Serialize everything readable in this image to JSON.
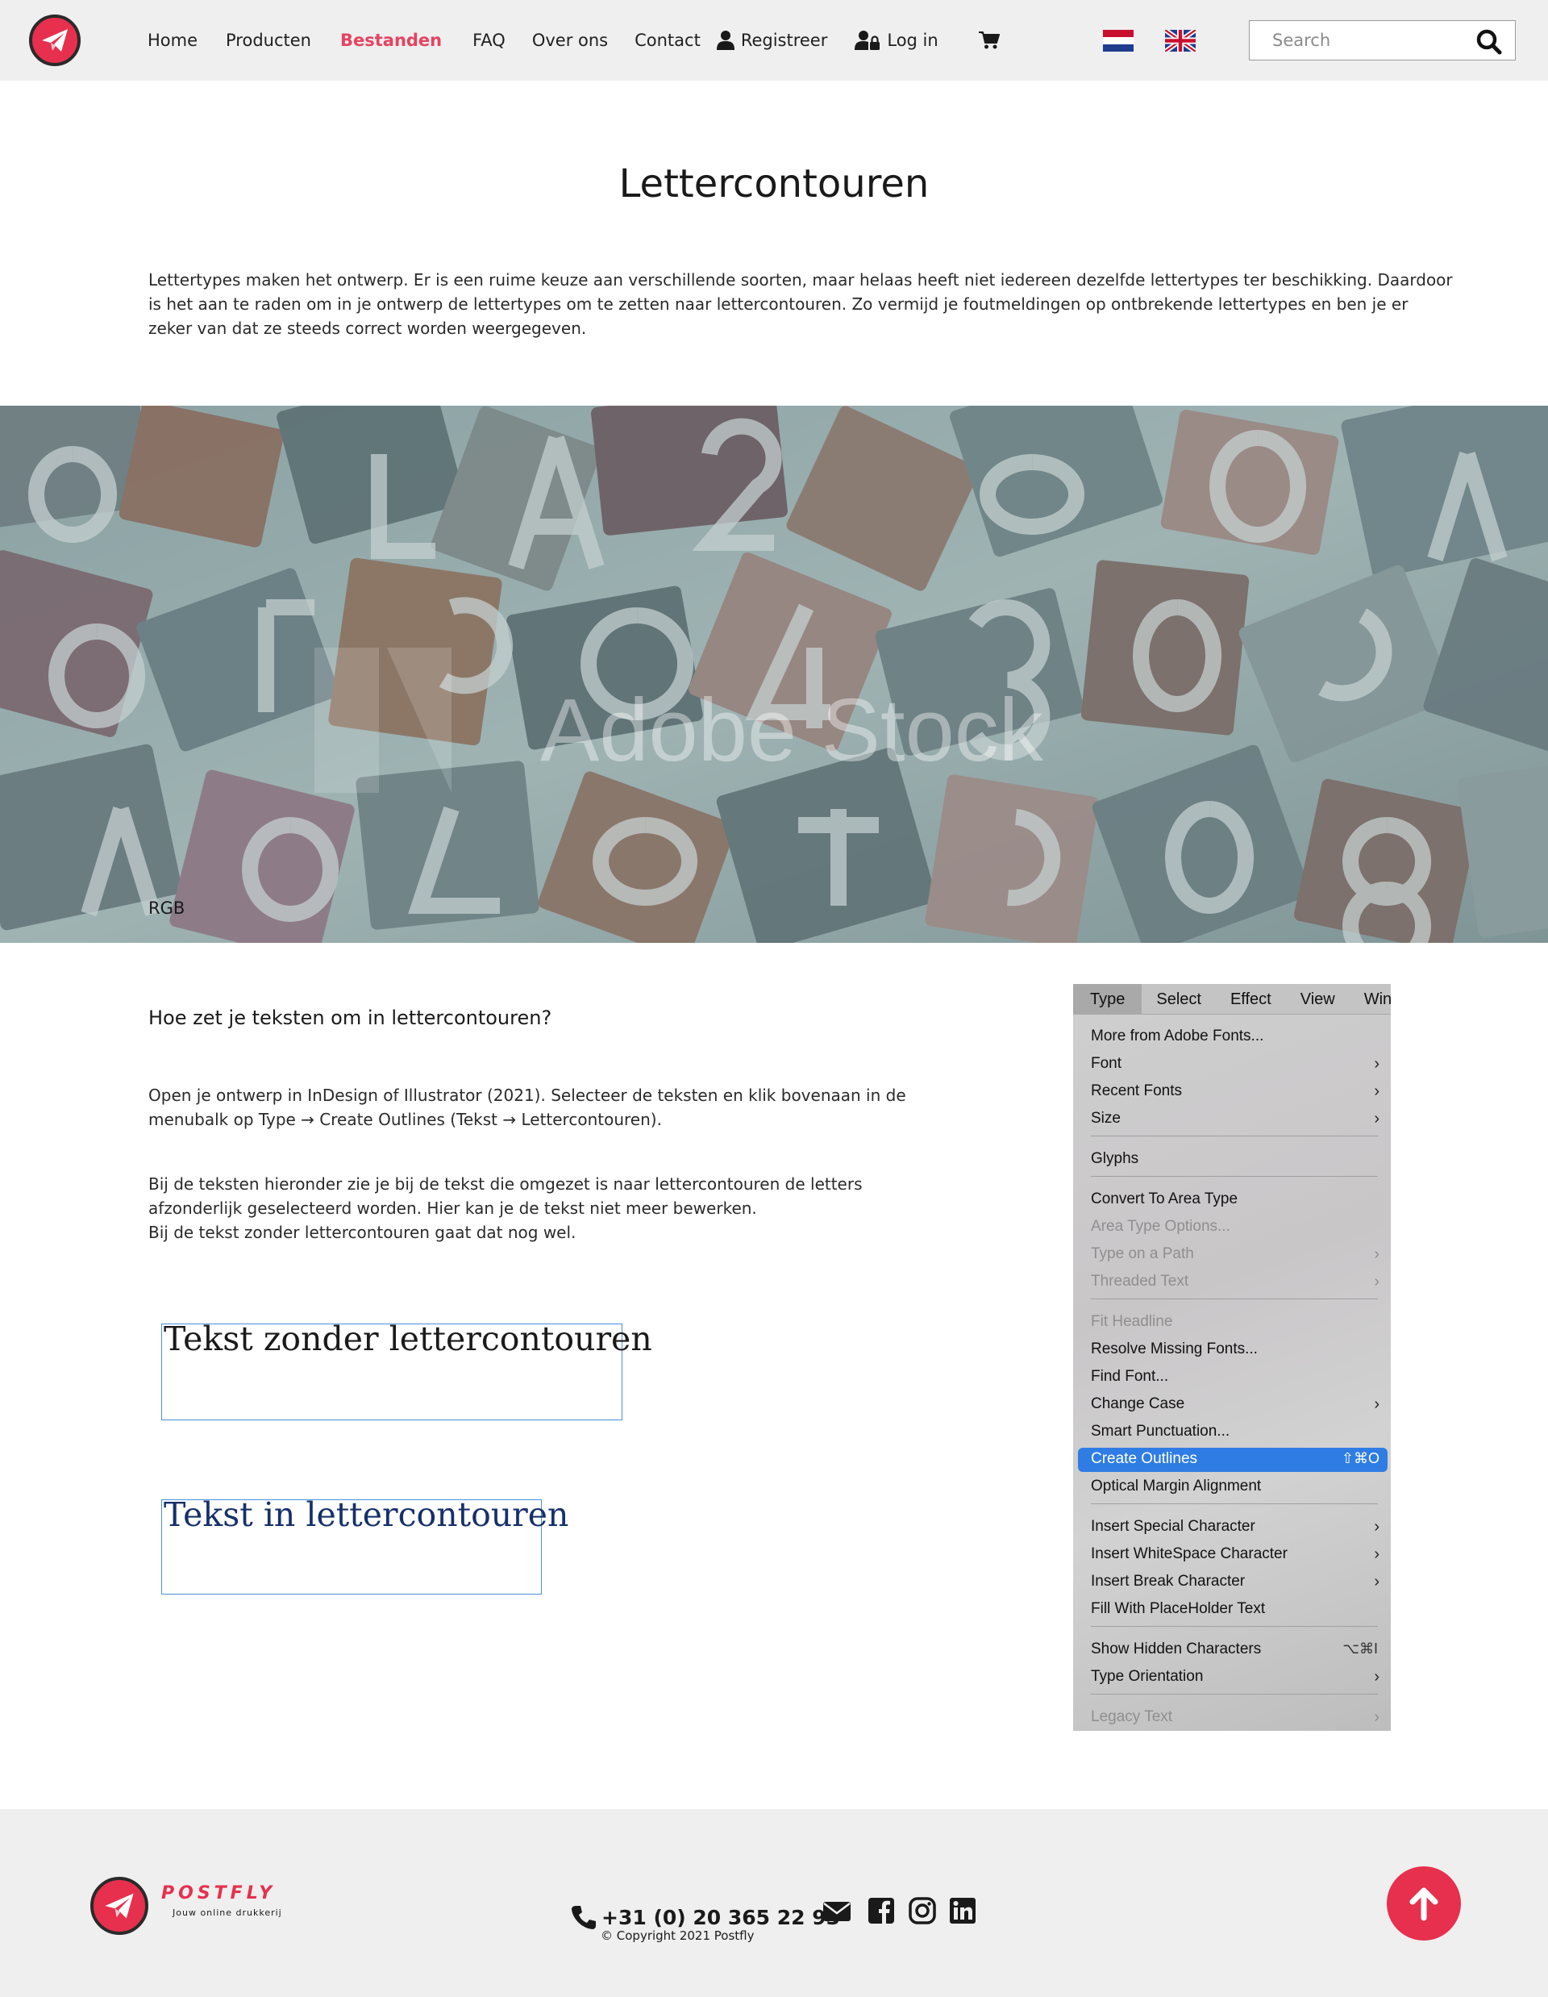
{
  "header": {
    "nav": [
      {
        "label": "Home",
        "active": false
      },
      {
        "label": "Producten",
        "active": false
      },
      {
        "label": "Bestanden",
        "active": true
      },
      {
        "label": "FAQ",
        "active": false
      },
      {
        "label": "Over ons",
        "active": false
      },
      {
        "label": "Contact",
        "active": false
      }
    ],
    "register_label": "Registreer",
    "login_label": "Log in",
    "search_placeholder": "Search",
    "icons": [
      "paper-plane-logo",
      "user-icon",
      "user-lock-icon",
      "cart-icon",
      "flag-nl",
      "flag-uk",
      "search-icon"
    ]
  },
  "main": {
    "title": "Lettercontouren",
    "intro": "Lettertypes maken het ontwerp. Er is een ruime keuze aan verschillende soorten, maar helaas heeft niet iedereen dezelfde lettertypes ter beschikking. Daardoor is het aan te raden om in je ontwerp de lettertypes om te zetten naar lettercontouren. Zo vermijd je foutmeldingen op ontbrekende lettertypes en ben je er zeker van dat ze steeds correct worden weergegeven.",
    "hero_watermark": "Adobe Stock",
    "hero_caption": "RGB",
    "heading": "Hoe zet je teksten om in lettercontouren?",
    "para1": "Open je ontwerp in InDesign of Illustrator (2021). Selecteer de teksten en klik bovenaan in de menubalk op Type → Create Outlines (Tekst → Lettercontouren).",
    "para2_line1": "Bij de teksten hieronder zie je bij de tekst die omgezet is naar lettercontouren de letters afzonderlijk geselecteerd worden. Hier kan je de tekst niet meer bewerken.",
    "para2_line2": "Bij de tekst zonder lettercontouren gaat dat nog wel.",
    "demo_plain": "Tekst zonder lettercontouren",
    "demo_outlined": "Tekst in lettercontouren"
  },
  "menu": {
    "bar": [
      "Type",
      "Select",
      "Effect",
      "View",
      "Wind"
    ],
    "items": [
      {
        "label": "More from Adobe Fonts...",
        "arrow": false,
        "disabled": false
      },
      {
        "label": "Font",
        "arrow": true,
        "disabled": false
      },
      {
        "label": "Recent Fonts",
        "arrow": true,
        "disabled": false
      },
      {
        "label": "Size",
        "arrow": true,
        "disabled": false
      },
      {
        "label": "Glyphs",
        "arrow": false,
        "disabled": false
      },
      {
        "label": "Convert To Area Type",
        "arrow": false,
        "disabled": false
      },
      {
        "label": "Area Type Options...",
        "arrow": false,
        "disabled": true
      },
      {
        "label": "Type on a Path",
        "arrow": true,
        "disabled": true
      },
      {
        "label": "Threaded Text",
        "arrow": true,
        "disabled": true
      },
      {
        "label": "Fit Headline",
        "arrow": false,
        "disabled": true
      },
      {
        "label": "Resolve Missing Fonts...",
        "arrow": false,
        "disabled": false
      },
      {
        "label": "Find Font...",
        "arrow": false,
        "disabled": false
      },
      {
        "label": "Change Case",
        "arrow": true,
        "disabled": false
      },
      {
        "label": "Smart Punctuation...",
        "arrow": false,
        "disabled": false
      },
      {
        "label": "Create Outlines",
        "shortcut": "⇧⌘O",
        "highlighted": true,
        "disabled": false
      },
      {
        "label": "Optical Margin Alignment",
        "arrow": false,
        "disabled": false
      },
      {
        "label": "Insert Special Character",
        "arrow": true,
        "disabled": false
      },
      {
        "label": "Insert WhiteSpace Character",
        "arrow": true,
        "disabled": false
      },
      {
        "label": "Insert Break Character",
        "arrow": true,
        "disabled": false
      },
      {
        "label": "Fill With PlaceHolder Text",
        "arrow": false,
        "disabled": false
      },
      {
        "label": "Show Hidden Characters",
        "shortcut": "⌥⌘I",
        "disabled": false
      },
      {
        "label": "Type Orientation",
        "arrow": true,
        "disabled": false
      },
      {
        "label": "Legacy Text",
        "arrow": true,
        "disabled": true
      }
    ]
  },
  "footer": {
    "brand": "POSTFLY",
    "tagline": "Jouw online drukkerij",
    "phone": "+31 (0) 20 365 22 93",
    "copyright": "© Copyright 2021 Postfly",
    "social_icons": [
      "envelope-icon",
      "facebook-icon",
      "instagram-icon",
      "linkedin-icon"
    ],
    "accent_color": "#e6304e"
  }
}
